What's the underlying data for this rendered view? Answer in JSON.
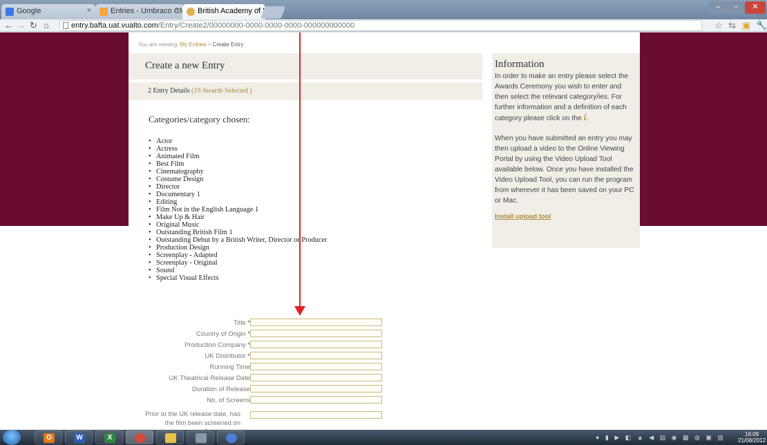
{
  "browser": {
    "tabs": [
      {
        "title": "Google",
        "color": "#3b78e7"
      },
      {
        "title": "Entries - Umbraco CMS - ...",
        "color": "#f2a63a"
      },
      {
        "title": "British Academy of Film an",
        "color": "#e0b050"
      }
    ],
    "url_host": "entry.bafta.uat.vualto.com",
    "url_path": "/Entry/Create2/00000000-0000-0000-0000-000000000000"
  },
  "breadcrumb": {
    "prefix": "You are viewing:",
    "link": "My Entries",
    "separator": ">",
    "current": "Create Entry"
  },
  "main": {
    "title": "Create a new Entry",
    "details_label": "2 Entry Details",
    "awards_selected": "(19 Awards Selected )",
    "categories_heading": "Categories/category chosen:",
    "categories": [
      "Actor",
      "Actress",
      "Animated Film",
      "Best Film",
      "Cinematography",
      "Costume Design",
      "Director",
      "Documentary 1",
      "Editing",
      "Film Not in the English Language 1",
      "Make Up & Hair",
      "Original Music",
      "Outstanding British Film 1",
      "Outstanding Debut by a British Writer, Director or Producer",
      "Production Design",
      "Screenplay - Adapted",
      "Screenplay - Original",
      "Sound",
      "Special Visual Effects"
    ]
  },
  "form": {
    "fields": [
      {
        "label": "Title",
        "required": "*"
      },
      {
        "label": "Country of Origin",
        "required": "*"
      },
      {
        "label": "Production Company",
        "required": "*"
      },
      {
        "label": "UK Distributor",
        "required": "*"
      },
      {
        "label": "Running Time",
        "required": ""
      },
      {
        "label": "UK Theatrical Release Date",
        "required": ""
      },
      {
        "label": "Duration of Release",
        "required": ""
      },
      {
        "label": "No. of Screens",
        "required": ""
      }
    ],
    "long_question": "Prior to the UK release date, has the film been screened on Television or"
  },
  "info": {
    "heading": "Information",
    "para1": "In order to make an entry please select the Awards Ceremony you wish to enter and then select the relevant category/ies. For further information and a definition of each category please click on the",
    "para1_end": ".",
    "para2": "When you have submitted an entry you may then upload a video to the Online Viewing Portal by using the Video Upload Tool available below. Once you have installed the Video Upload Tool, you can run the program from wherever it has been saved on your PC or Mac.",
    "upload_link": "Install upload tool"
  },
  "taskbar": {
    "clock_time": "16:09",
    "clock_date": "21/08/2012"
  }
}
